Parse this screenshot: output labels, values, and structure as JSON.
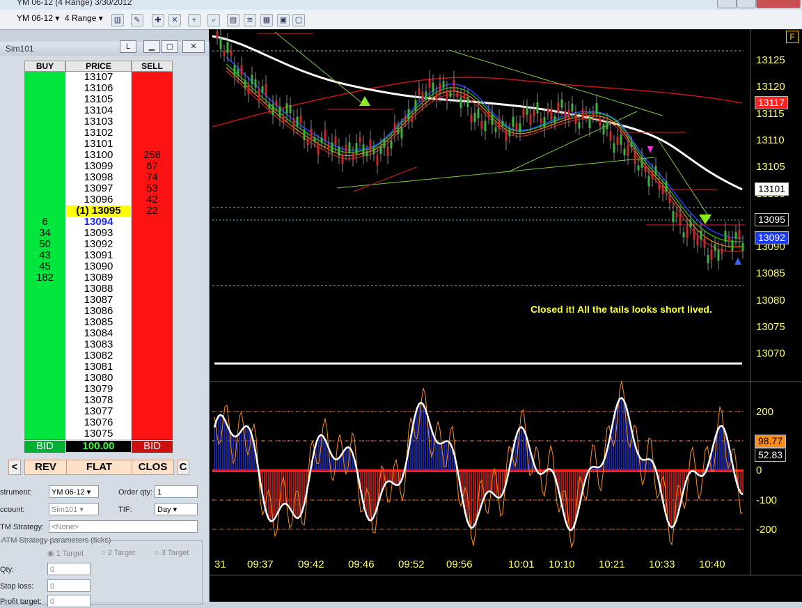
{
  "window": {
    "title": "YM 06-12 (4 Range)  3/30/2012"
  },
  "toolbar": {
    "instrument": "YM 06-12",
    "interval": "4 Range",
    "f_label": "F"
  },
  "dom": {
    "title": "Sim101",
    "l_button": "L",
    "headers": {
      "buy": "BUY",
      "price": "PRICE",
      "sell": "SELL"
    },
    "rows": [
      {
        "buy": "",
        "price": "13107",
        "sell": ""
      },
      {
        "buy": "",
        "price": "13106",
        "sell": ""
      },
      {
        "buy": "",
        "price": "13105",
        "sell": ""
      },
      {
        "buy": "",
        "price": "13104",
        "sell": ""
      },
      {
        "buy": "",
        "price": "13103",
        "sell": ""
      },
      {
        "buy": "",
        "price": "13102",
        "sell": ""
      },
      {
        "buy": "",
        "price": "13101",
        "sell": ""
      },
      {
        "buy": "",
        "price": "13100",
        "sell": "258"
      },
      {
        "buy": "",
        "price": "13099",
        "sell": "67"
      },
      {
        "buy": "",
        "price": "13098",
        "sell": "74"
      },
      {
        "buy": "",
        "price": "13097",
        "sell": "53"
      },
      {
        "buy": "",
        "price": "13096",
        "sell": "42"
      },
      {
        "buy": "",
        "price": "(1) 13095",
        "sell": "22",
        "position": true
      },
      {
        "buy": "6",
        "price": "13094",
        "sell": "",
        "last": true
      },
      {
        "buy": "34",
        "price": "13093",
        "sell": ""
      },
      {
        "buy": "50",
        "price": "13092",
        "sell": ""
      },
      {
        "buy": "43",
        "price": "13091",
        "sell": ""
      },
      {
        "buy": "45",
        "price": "13090",
        "sell": ""
      },
      {
        "buy": "182",
        "price": "13089",
        "sell": ""
      },
      {
        "buy": "",
        "price": "13088",
        "sell": ""
      },
      {
        "buy": "",
        "price": "13087",
        "sell": ""
      },
      {
        "buy": "",
        "price": "13086",
        "sell": ""
      },
      {
        "buy": "",
        "price": "13085",
        "sell": ""
      },
      {
        "buy": "",
        "price": "13084",
        "sell": ""
      },
      {
        "buy": "",
        "price": "13083",
        "sell": ""
      },
      {
        "buy": "",
        "price": "13082",
        "sell": ""
      },
      {
        "buy": "",
        "price": "13081",
        "sell": ""
      },
      {
        "buy": "",
        "price": "13080",
        "sell": ""
      },
      {
        "buy": "",
        "price": "13079",
        "sell": ""
      },
      {
        "buy": "",
        "price": "13078",
        "sell": ""
      },
      {
        "buy": "",
        "price": "13077",
        "sell": ""
      },
      {
        "buy": "",
        "price": "13076",
        "sell": ""
      },
      {
        "buy": "",
        "price": "13075",
        "sell": ""
      }
    ],
    "footer": {
      "bid_left": "BID",
      "pnl": "100.00",
      "bid_right": "BID"
    },
    "buttons": {
      "left": "<",
      "rev": "REV",
      "flat": "FLAT",
      "clos": "CLOS",
      "c": "C"
    },
    "form": {
      "instrument_label": "strument:",
      "instrument_value": "YM 06-12",
      "order_qty_label": "Order qty:",
      "order_qty_value": "1",
      "account_label": "ccount:",
      "account_value": "Sim101",
      "tif_label": "TIF:",
      "tif_value": "Day",
      "atm_label": "TM Strategy:",
      "atm_value": "<None>",
      "params_label": "ATM Strategy parameters (ticks)",
      "target1": "1 Target",
      "target2": "2 Target",
      "target3": "3 Target",
      "qty_label": "Qty:",
      "qty_value": "0",
      "stop_label": "Stop loss:",
      "stop_value": "0",
      "profit_label": "Profit target:",
      "profit_value": "0"
    }
  },
  "chart": {
    "annotation": "Closed it!  All the tails looks short lived.",
    "price_axis": [
      "13125",
      "13120",
      "13115",
      "13110",
      "13105",
      "13100",
      "13095",
      "13090",
      "13085",
      "13080",
      "13075",
      "13070"
    ],
    "price_flags": [
      {
        "label": "13117",
        "color": "#ff2020",
        "text": "#ffffff"
      },
      {
        "label": "13101",
        "color": "#ffffff",
        "text": "#000000"
      },
      {
        "label": "13095",
        "color": "#000000",
        "text": "#ffffff"
      },
      {
        "label": "13092",
        "color": "#1a3cff",
        "text": "#ffffff"
      }
    ],
    "osc_axis": [
      "200",
      "100",
      "0",
      "-100",
      "-200"
    ],
    "osc_flags": [
      {
        "label": "98.77",
        "color": "#ff8c1a",
        "text": "#000000"
      },
      {
        "label": "52.83",
        "color": "#000000",
        "text": "#ffffff"
      }
    ],
    "time_axis": [
      "31",
      "09:37",
      "09:42",
      "09:46",
      "09:52",
      "09:56",
      "10:01",
      "10:10",
      "10:21",
      "10:33",
      "10:40"
    ]
  },
  "colors": {
    "buy": "#00e63c",
    "sell": "#ff1212",
    "axis_text": "#ffff66",
    "position": "#ffff00"
  }
}
